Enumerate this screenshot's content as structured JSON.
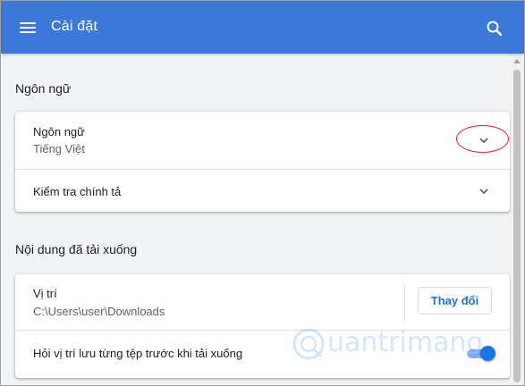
{
  "app_bar": {
    "title": "Cài đặt",
    "background_color": "#3c78d8",
    "menu_icon": "hamburger-menu-icon",
    "search_icon": "search-icon"
  },
  "languages_section": {
    "heading": "Ngôn ngữ",
    "language_row": {
      "label": "Ngôn ngữ",
      "value": "Tiếng Việt",
      "expand_icon": "chevron-down-icon",
      "highlight_color": "#e0211c"
    },
    "spellcheck_row": {
      "label": "Kiểm tra chính tả",
      "expand_icon": "chevron-down-icon"
    }
  },
  "downloads_section": {
    "heading": "Nội dung đã tải xuống",
    "location_row": {
      "label": "Vị trí",
      "value": "C:\\Users\\user\\Downloads",
      "button_label": "Thay đổi"
    },
    "ask_row": {
      "label": "Hỏi vị trí lưu từng tệp trước khi tải xuống",
      "toggle_on": true,
      "accent_color": "#1a73e8"
    }
  },
  "watermark": {
    "logo_icon": "quantrimang-logo",
    "text": "uantrimang"
  }
}
